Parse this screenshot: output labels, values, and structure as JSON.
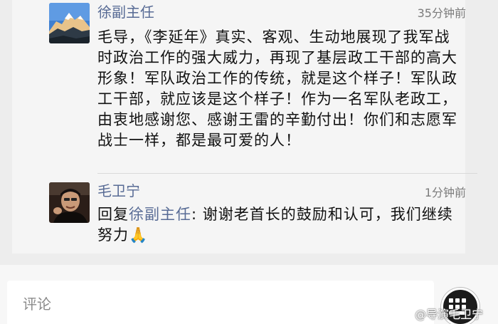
{
  "comments": [
    {
      "author": "徐副主任",
      "time": "35分钟前",
      "avatar_icon": "mountain-landscape-avatar",
      "text": "毛导，《李延年》真实、客观、生动地展现了我军战时政治工作的强大威力，再现了基层政工干部的高大形象！军队政治工作的传统，就是这个样子！军队政工干部，就应该是这个样子！作为一名军队老政工，由衷地感谢您、感谢王雷的辛勤付出！你们和志愿军战士一样，都是最可爱的人！"
    },
    {
      "author": "毛卫宁",
      "time": "1分钟前",
      "avatar_icon": "person-portrait-avatar",
      "reply_prefix": "回复",
      "reply_to": "徐副主任",
      "reply_colon": ": ",
      "text": "谢谢老首长的鼓励和认可，我们继续努力",
      "emoji": "🙏"
    }
  ],
  "input": {
    "placeholder": "评论"
  },
  "keyboard_icon": "keyboard-grid-icon",
  "watermark": {
    "text": "@导演毛卫宁"
  },
  "colors": {
    "name_link": "#586b95",
    "background": "#ededed",
    "card": "#f5f5f5"
  }
}
